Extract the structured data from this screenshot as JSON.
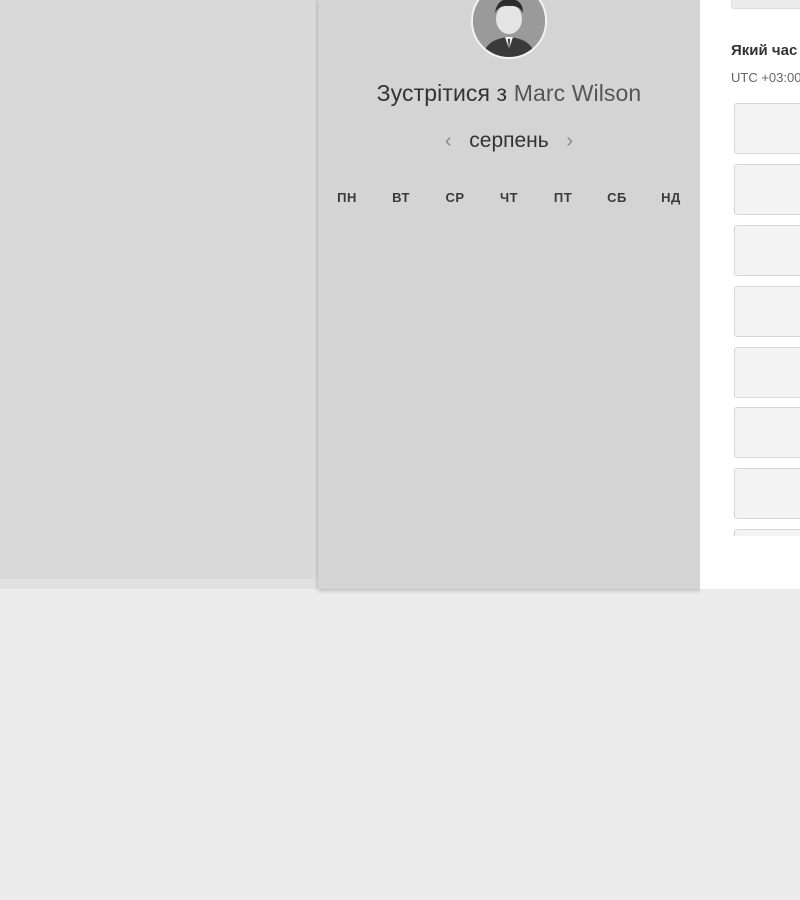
{
  "meeting": {
    "prefix": "Зустрітися з",
    "host": "Marc Wilson"
  },
  "calendar": {
    "month": "серпень",
    "prev_icon": "chevron-left-icon",
    "next_icon": "chevron-right-icon",
    "prev_glyph": "‹",
    "next_glyph": "›",
    "weekdays": [
      "ПН",
      "ВТ",
      "СР",
      "ЧТ",
      "ПТ",
      "СБ",
      "НД"
    ]
  },
  "times": {
    "title": "Який час",
    "timezone": "UTC +03:00"
  },
  "colors": {
    "background": "#ececec",
    "calendar_panel": "#d4d4d4",
    "left_pane": "#d9d9d9",
    "times_panel": "#ffffff"
  }
}
